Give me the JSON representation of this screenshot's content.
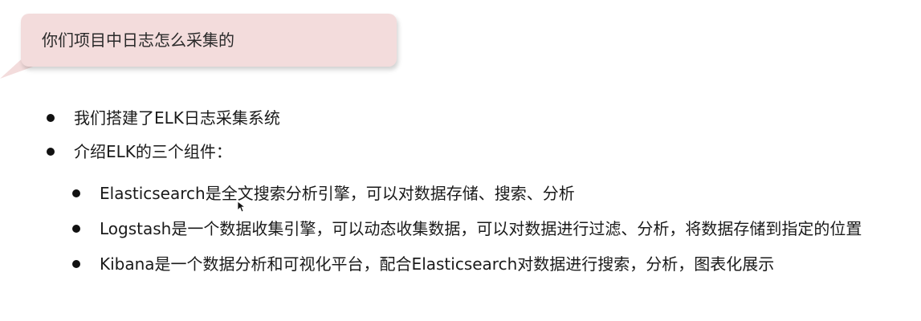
{
  "question": {
    "text": "你们项目中日志怎么采集的"
  },
  "points": [
    {
      "text": "我们搭建了ELK日志采集系统"
    },
    {
      "text": "介绍ELK的三个组件："
    }
  ],
  "components": [
    {
      "text": "Elasticsearch是全文搜索分析引擎，可以对数据存储、搜索、分析"
    },
    {
      "text": "Logstash是一个数据收集引擎，可以动态收集数据，可以对数据进行过滤、分析，将数据存储到指定的位置"
    },
    {
      "text": "Kibana是一个数据分析和可视化平台，配合Elasticsearch对数据进行搜索，分析，图表化展示"
    }
  ],
  "colors": {
    "bubble_fill": "#f3dcdc",
    "text": "#1a1a1a",
    "background": "#ffffff"
  },
  "icons": {
    "cursor": "mouse-pointer-icon"
  }
}
